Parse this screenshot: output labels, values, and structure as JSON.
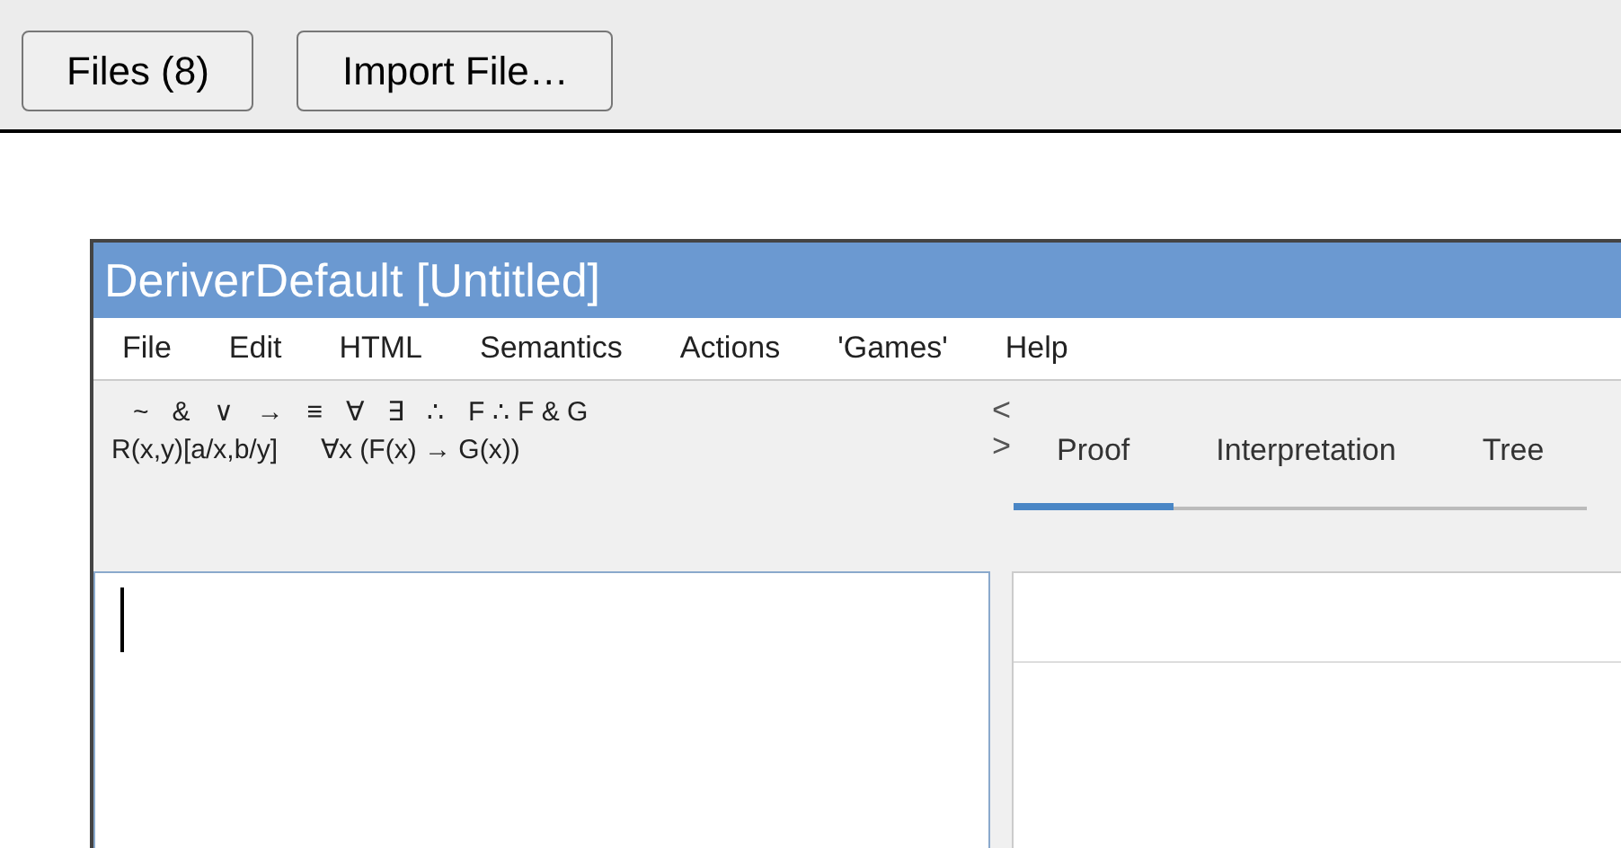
{
  "top_bar": {
    "buttons": [
      "Files (8)",
      "Import File…"
    ]
  },
  "window": {
    "title": "DeriverDefault [Untitled]",
    "menu": [
      "File",
      "Edit",
      "HTML",
      "Semantics",
      "Actions",
      "'Games'",
      "Help"
    ],
    "symbols": [
      "~",
      "&",
      "∨",
      "→",
      "≡",
      "∀",
      "∃",
      "∴",
      "F ∴ F & G"
    ],
    "examples": [
      "R(x,y)[a/x,b/y]",
      "∀x (F(x) → G(x))"
    ],
    "tab_scroll": [
      "<",
      ">"
    ],
    "tabs": [
      {
        "label": "Proof",
        "selected": true
      },
      {
        "label": "Interpretation",
        "selected": false
      },
      {
        "label": "Tree",
        "selected": false
      }
    ]
  }
}
